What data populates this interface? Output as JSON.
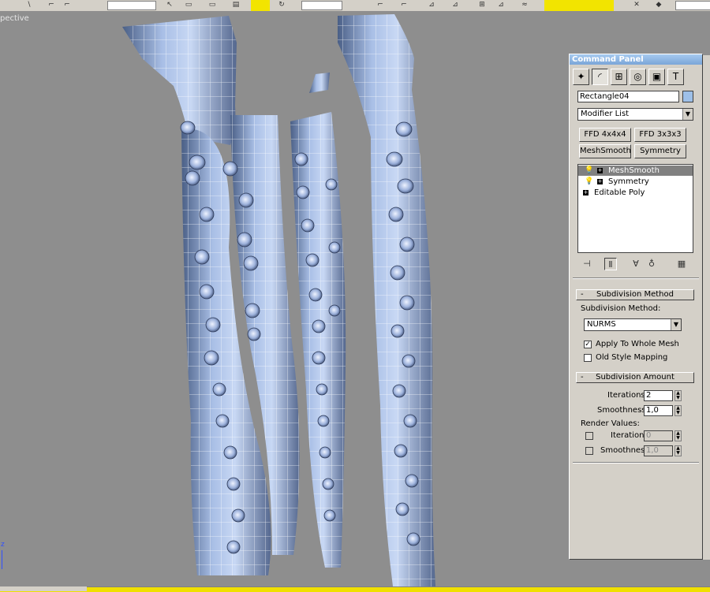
{
  "viewport": {
    "label": "pective",
    "axis": "z"
  },
  "command_panel": {
    "title": "Command Panel",
    "tabs": [
      {
        "name": "create-tab-icon",
        "glyph": "✦"
      },
      {
        "name": "modify-tab-icon",
        "glyph": "◜"
      },
      {
        "name": "hierarchy-tab-icon",
        "glyph": "⊞"
      },
      {
        "name": "motion-tab-icon",
        "glyph": "◎"
      },
      {
        "name": "display-tab-icon",
        "glyph": "▣"
      },
      {
        "name": "utilities-tab-icon",
        "glyph": "T"
      }
    ],
    "object_name": "Rectangle04",
    "swatch_color": "#9ec0e8",
    "modifier_list": "Modifier List",
    "buttons": [
      "FFD 4x4x4",
      "FFD 3x3x3",
      "MeshSmooth",
      "Symmetry"
    ],
    "stack": [
      {
        "label": "MeshSmooth",
        "selected": true,
        "bulb": true
      },
      {
        "label": "Symmetry",
        "selected": false,
        "bulb": true
      },
      {
        "label": "Editable Poly",
        "selected": false,
        "bulb": false
      }
    ],
    "subdivision_method": {
      "title": "Subdivision Method",
      "label": "Subdivision Method:",
      "value": "NURMS",
      "apply_whole_mesh": "Apply To Whole Mesh",
      "apply_whole_mesh_checked": true,
      "old_style": "Old Style Mapping",
      "old_style_checked": false
    },
    "subdivision_amount": {
      "title": "Subdivision Amount",
      "iterations_label": "Iterations:",
      "iterations": "2",
      "smoothness_label": "Smoothness:",
      "smoothness": "1,0",
      "render_values_label": "Render Values:",
      "render_iterations_label": "Iterations:",
      "render_iterations": "0",
      "render_smoothness_label": "Smoothness:",
      "render_smoothness": "1,0"
    }
  }
}
